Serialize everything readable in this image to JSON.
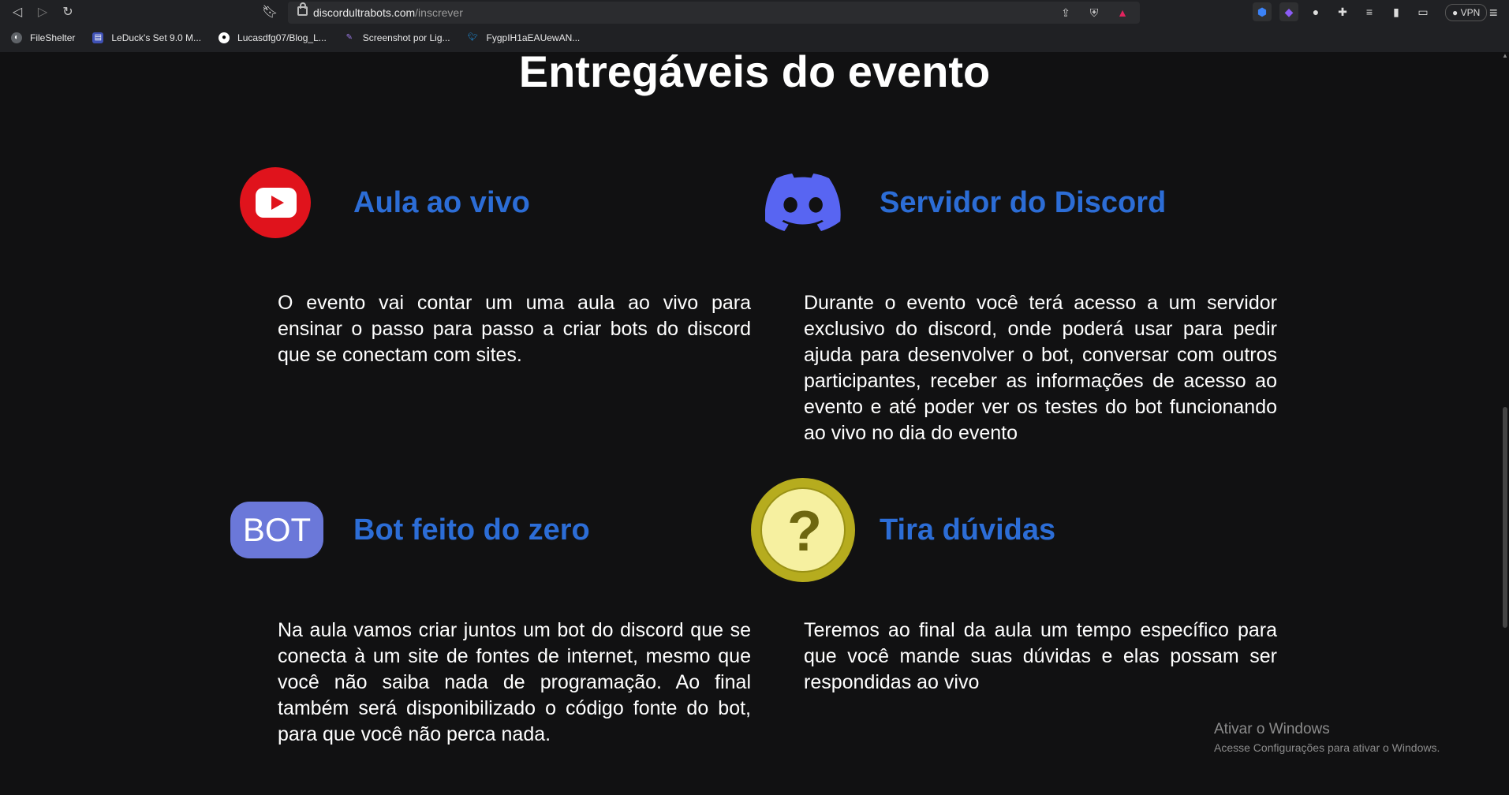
{
  "browser": {
    "url_domain": "discordultrabots.com",
    "url_path": "/inscrever",
    "vpn_label": "VPN",
    "bookmarks": [
      {
        "label": "FileShelter",
        "color": "#5f6368"
      },
      {
        "label": "LeDuck's Set 9.0 M...",
        "color": "#3f51b5"
      },
      {
        "label": "Lucasdfg07/Blog_L...",
        "color": "#444444"
      },
      {
        "label": "Screenshot por Lig...",
        "color": "#7e57c2"
      },
      {
        "label": "FygpIH1aEAUewAN...",
        "color": "#1d9bf0"
      }
    ]
  },
  "page": {
    "title": "Entregáveis do evento",
    "items": [
      {
        "heading": "Aula ao vivo",
        "icon": "youtube-icon",
        "description": "O evento vai contar um uma aula ao vivo para ensinar o passo para passo a criar bots do discord que se conectam com sites."
      },
      {
        "heading": "Servidor do Discord",
        "icon": "discord-icon",
        "description": "Durante o evento você terá acesso a um servidor exclusivo do discord, onde poderá usar para pedir ajuda para desenvolver o bot, conversar com outros participantes, receber as informações de acesso ao evento e até poder ver os testes do bot funcionando ao vivo no dia do evento"
      },
      {
        "heading": "Bot feito do zero",
        "icon": "bot-icon",
        "icon_text": "BOT",
        "description": "Na aula vamos criar juntos um bot do discord que se conecta à um site de fontes de internet, mesmo que você não saiba nada de programação. Ao final também será disponibilizado o código fonte do bot, para que você não perca nada."
      },
      {
        "heading": "Tira dúvidas",
        "icon": "question-coin-icon",
        "icon_text": "?",
        "description": "Teremos ao final da aula um tempo específico para que você mande suas dúvidas e elas possam ser respondidas ao vivo"
      }
    ]
  },
  "watermark": {
    "title": "Ativar o Windows",
    "subtitle": "Acesse Configurações para ativar o Windows."
  },
  "colors": {
    "heading": "#2c6dd6",
    "background": "#111112",
    "youtube_red": "#e0131c",
    "discord_blue": "#5865f2",
    "bot_blue": "#6b78d9"
  }
}
